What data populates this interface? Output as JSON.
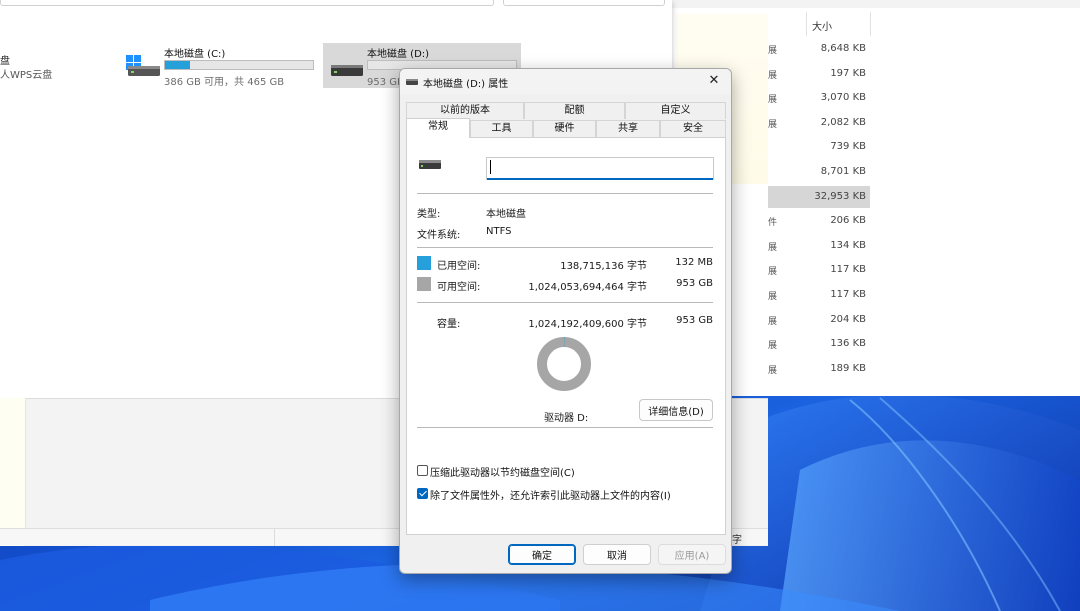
{
  "explorer_left": {
    "nav_label": "盘",
    "nav_sublabel": "人WPS云盘",
    "drives": [
      {
        "name": "本地磁盘 (C:)",
        "free_text": "386 GB 可用，共 465 GB",
        "used_fraction": 0.17,
        "selected": false
      },
      {
        "name": "本地磁盘 (D:)",
        "free_text": "953 GB 可用，共 953 GB",
        "used_fraction": 0.0,
        "selected": true
      }
    ]
  },
  "explorer_right": {
    "size_header": "大小",
    "rows": [
      {
        "frag": "展",
        "size": "8,648 KB"
      },
      {
        "frag": "展",
        "size": "197 KB"
      },
      {
        "frag": "展",
        "size": "3,070 KB"
      },
      {
        "frag": "展",
        "size": "2,082 KB"
      },
      {
        "frag": "",
        "size": "739 KB"
      },
      {
        "frag": "",
        "size": "8,701 KB"
      },
      {
        "frag": "",
        "size": "32,953 KB",
        "selected": true
      },
      {
        "frag": "件",
        "size": "206 KB"
      },
      {
        "frag": "展",
        "size": "134 KB"
      },
      {
        "frag": "展",
        "size": "117 KB"
      },
      {
        "frag": "展",
        "size": "117 KB"
      },
      {
        "frag": "展",
        "size": "204 KB"
      },
      {
        "frag": "展",
        "size": "136 KB"
      },
      {
        "frag": "展",
        "size": "189 KB"
      }
    ],
    "status_fragment": "字"
  },
  "dialog": {
    "title": "本地磁盘 (D:) 属性",
    "close_glyph": "✕",
    "tabs_row1": [
      "以前的版本",
      "配额",
      "自定义"
    ],
    "tabs_row2": [
      "常规",
      "工具",
      "硬件",
      "共享",
      "安全"
    ],
    "active_tab": "常规",
    "name_value": "",
    "type_label": "类型:",
    "type_value": "本地磁盘",
    "fs_label": "文件系统:",
    "fs_value": "NTFS",
    "used_label": "已用空间:",
    "used_bytes": "138,715,136 字节",
    "used_human": "132 MB",
    "free_label": "可用空间:",
    "free_bytes": "1,024,053,694,464 字节",
    "free_human": "953 GB",
    "capacity_label": "容量:",
    "capacity_bytes": "1,024,192,409,600 字节",
    "capacity_human": "953 GB",
    "used_fraction": 0.000135,
    "drive_label": "驱动器 D:",
    "details_button": "详细信息(D)",
    "compress_label": "压缩此驱动器以节约磁盘空间(C)",
    "compress_checked": false,
    "index_label": "除了文件属性外，还允许索引此驱动器上文件的内容(I)",
    "index_checked": true,
    "ok_button": "确定",
    "cancel_button": "取消",
    "apply_button": "应用(A)"
  },
  "colors": {
    "used_color": "#26a0da",
    "free_color": "#a6a6a6",
    "accent": "#0067c0"
  }
}
